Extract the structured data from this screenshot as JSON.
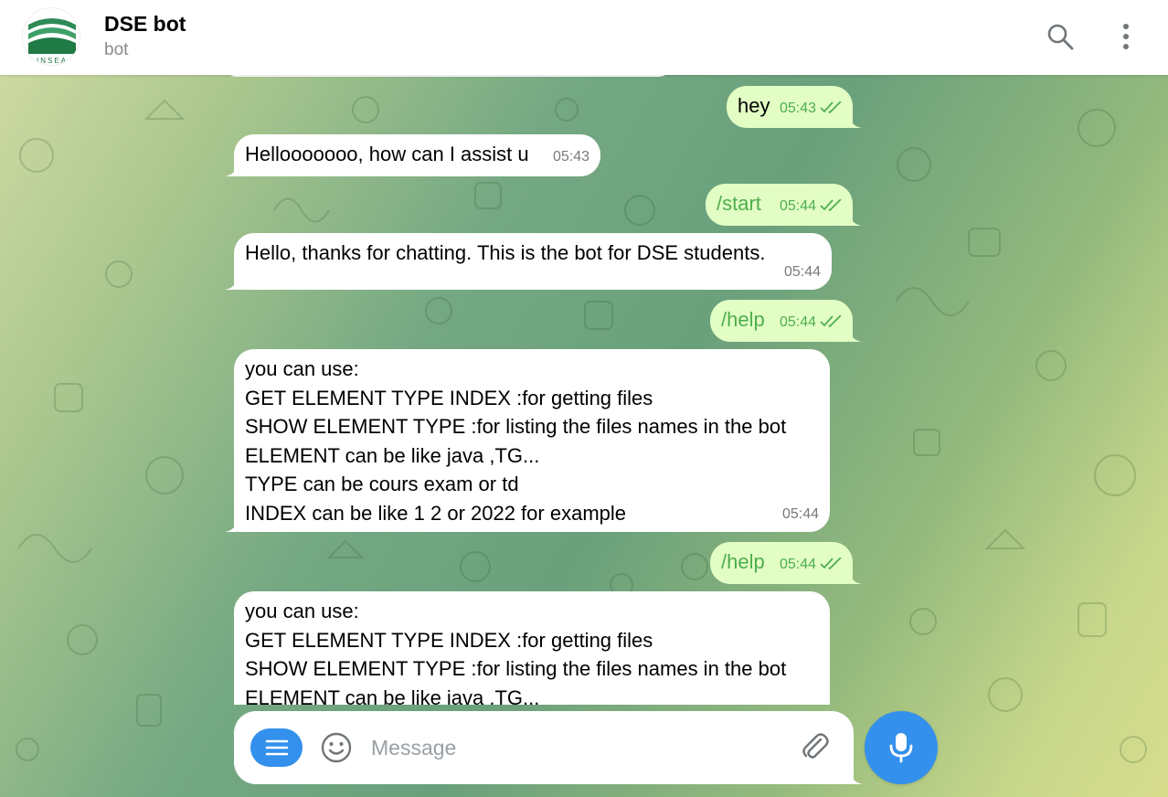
{
  "header": {
    "title": "DSE bot",
    "subtitle": "bot",
    "avatar_text": "INSEA"
  },
  "messages": [
    {
      "direction": "out",
      "text": "hey",
      "time": "05:43",
      "status": "read"
    },
    {
      "direction": "in",
      "text": "Hellooooooo, how can I assist u",
      "time": "05:43"
    },
    {
      "direction": "out",
      "text": "/start",
      "time": "05:44",
      "status": "read"
    },
    {
      "direction": "in",
      "text": "Hello, thanks for chatting. This is the bot for DSE students.",
      "time": "05:44"
    },
    {
      "direction": "out",
      "text": "/help",
      "time": "05:44",
      "status": "read"
    },
    {
      "direction": "in",
      "lines": [
        "you can use:",
        "GET ELEMENT TYPE INDEX :for getting files",
        "SHOW ELEMENT TYPE :for listing the files names in the bot",
        "ELEMENT can be like java ,TG...",
        "TYPE can be cours exam or td",
        "INDEX can be like 1 2 or 2022 for example"
      ],
      "time": "05:44"
    },
    {
      "direction": "out",
      "text": "/help",
      "time": "05:44",
      "status": "read"
    },
    {
      "direction": "in",
      "lines": [
        "you can use:",
        "GET ELEMENT TYPE INDEX :for getting files",
        "SHOW ELEMENT TYPE :for listing the files names in the bot",
        "ELEMENT can be like java ,TG..."
      ]
    }
  ],
  "composer": {
    "placeholder": "Message"
  },
  "icons": {
    "search": "search-icon",
    "more": "more-vertical-icon",
    "menu": "menu-icon",
    "emoji": "smile-icon",
    "attach": "paperclip-icon",
    "mic": "microphone-icon",
    "read": "double-check-icon"
  },
  "colors": {
    "accent": "#3390ec",
    "outgoing_bubble": "#e2fec5",
    "outgoing_text": "#4fae4e",
    "incoming_bubble": "#ffffff",
    "header_bg": "#ffffff"
  }
}
